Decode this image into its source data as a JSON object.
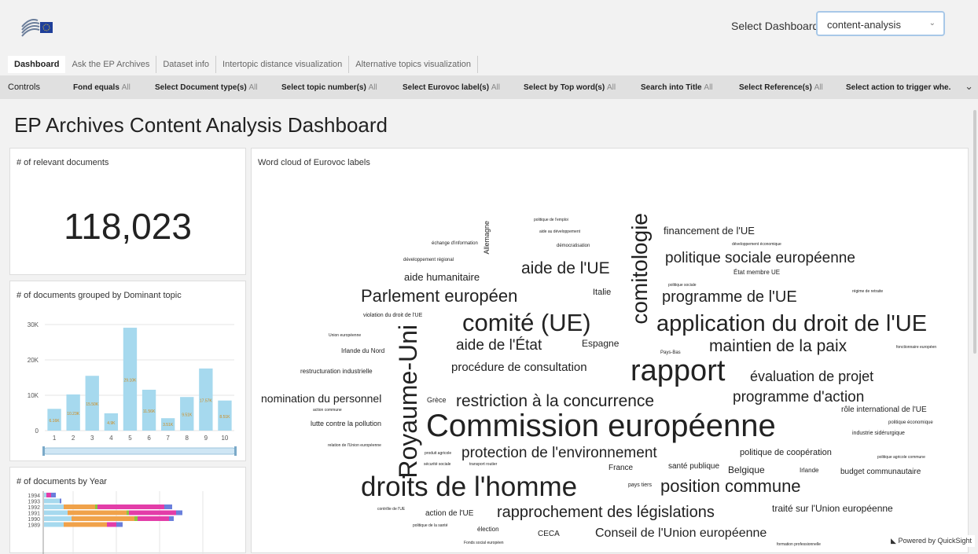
{
  "header": {
    "select_label": "Select Dashboard",
    "select_value": "content-analysis"
  },
  "tabs": [
    "Dashboard",
    "Ask the EP Archives",
    "Dataset info",
    "Intertopic distance visualization",
    "Alternative topics visualization"
  ],
  "controls": {
    "title": "Controls",
    "all_label": "All",
    "items": [
      "Fond equals",
      "Select Document type(s)",
      "Select topic number(s)",
      "Select Eurovoc label(s)",
      "Select by Top word(s)",
      "Search into Title",
      "Select Reference(s)",
      "Select action to trigger whe."
    ]
  },
  "page_title": "EP Archives Content Analysis Dashboard",
  "kpi": {
    "title": "# of relevant documents",
    "value": "118,023"
  },
  "topic_chart": {
    "title": "# of documents grouped by Dominant topic",
    "chart_data": {
      "type": "bar",
      "categories": [
        "1",
        "2",
        "3",
        "4",
        "5",
        "6",
        "7",
        "8",
        "9",
        "10"
      ],
      "values": [
        6160,
        10236,
        15500,
        4900,
        29100,
        11566,
        3512,
        9510,
        17570,
        8510
      ],
      "data_labels": [
        "6.16K",
        "10.23K",
        "15.50K",
        "4.9K",
        "29.10K",
        "11.56K",
        "3.51K",
        "9.51K",
        "17.57K",
        "8.51K"
      ],
      "yticks": [
        "0",
        "10K",
        "20K",
        "30K"
      ],
      "ylim": [
        0,
        32000
      ],
      "bar_color": "#a6d9ee"
    }
  },
  "year_chart": {
    "title": "# of documents by Year",
    "chart_data": {
      "type": "bar",
      "orientation": "horizontal-stacked",
      "categories": [
        "1994",
        "1993",
        "1992",
        "1991",
        "1990",
        "1989"
      ],
      "series_colors": [
        "#a6d9ee",
        "#f0a24a",
        "#8cc63f",
        "#e33da8",
        "#6a7fdc",
        "#4aa3df"
      ],
      "values": [
        [
          3,
          0,
          0,
          6,
          6,
          0
        ],
        [
          20,
          0,
          0,
          0,
          2,
          0
        ],
        [
          25,
          40,
          3,
          85,
          10,
          0
        ],
        [
          30,
          75,
          3,
          60,
          8,
          0
        ],
        [
          35,
          80,
          4,
          40,
          6,
          0
        ],
        [
          25,
          55,
          0,
          12,
          8,
          0
        ]
      ],
      "visible_tick_labels": [
        "1994",
        "1993",
        "1992",
        "1991",
        "1990",
        "1989"
      ]
    }
  },
  "wordcloud": {
    "title": "Word cloud of Eurovoc labels",
    "words": [
      {
        "text": "politique de l'emploi"
      },
      {
        "text": "aide au développement"
      },
      {
        "text": "échange d'information"
      },
      {
        "text": "démocratisation"
      },
      {
        "text": "Allemagne"
      },
      {
        "text": "développement régional"
      },
      {
        "text": "aide de l'UE"
      },
      {
        "text": "comitologie"
      },
      {
        "text": "financement de l'UE"
      },
      {
        "text": "développement économique"
      },
      {
        "text": "politique sociale européenne"
      },
      {
        "text": "État membre UE"
      },
      {
        "text": "aide humanitaire"
      },
      {
        "text": "politique sociale"
      },
      {
        "text": "Parlement européen"
      },
      {
        "text": "Italie"
      },
      {
        "text": "programme de l'UE"
      },
      {
        "text": "régime de retraite"
      },
      {
        "text": "violation du droit de l'UE"
      },
      {
        "text": "comité (UE)"
      },
      {
        "text": "application du droit de l'UE"
      },
      {
        "text": "Union européenne"
      },
      {
        "text": "aide de l'État"
      },
      {
        "text": "Espagne"
      },
      {
        "text": "maintien de la paix"
      },
      {
        "text": "Irlande du Nord"
      },
      {
        "text": "Pays-Bas"
      },
      {
        "text": "fonctionnaire européen"
      },
      {
        "text": "Royaume-Uni"
      },
      {
        "text": "procédure de consultation"
      },
      {
        "text": "rapport"
      },
      {
        "text": "restructuration industrielle"
      },
      {
        "text": "évaluation de projet"
      },
      {
        "text": "nomination du personnel"
      },
      {
        "text": "Grèce"
      },
      {
        "text": "restriction à la concurrence"
      },
      {
        "text": "programme d'action"
      },
      {
        "text": "rôle international de l'UE"
      },
      {
        "text": "action commune"
      },
      {
        "text": "politique économique"
      },
      {
        "text": "lutte contre la pollution"
      },
      {
        "text": "Commission européenne"
      },
      {
        "text": "industrie sidérurgique"
      },
      {
        "text": "relation de l'Union européenne"
      },
      {
        "text": "protection de l'environnement"
      },
      {
        "text": "politique de coopération"
      },
      {
        "text": "politique agricole commune"
      },
      {
        "text": "produit agricole"
      },
      {
        "text": "sécurité sociale"
      },
      {
        "text": "transport routier"
      },
      {
        "text": "France"
      },
      {
        "text": "santé publique"
      },
      {
        "text": "Belgique"
      },
      {
        "text": "Irlande"
      },
      {
        "text": "budget communautaire"
      },
      {
        "text": "droits de l'homme"
      },
      {
        "text": "pays tiers"
      },
      {
        "text": "position commune"
      },
      {
        "text": "contrôle de l'UE"
      },
      {
        "text": "action de l'UE"
      },
      {
        "text": "rapprochement des législations"
      },
      {
        "text": "traité sur l'Union européenne"
      },
      {
        "text": "politique de la santé"
      },
      {
        "text": "élection"
      },
      {
        "text": "CECA"
      },
      {
        "text": "Conseil de l'Union européenne"
      },
      {
        "text": "Fonds social européen"
      },
      {
        "text": "formation professionnelle"
      }
    ]
  },
  "footer": {
    "powered_by": "Powered by QuickSight"
  }
}
